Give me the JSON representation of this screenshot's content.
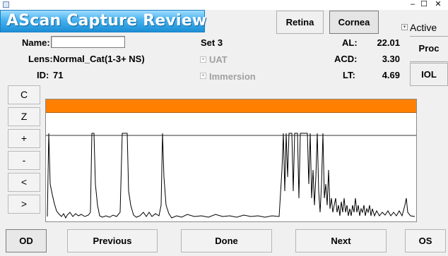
{
  "window": {
    "minimize_glyph": "–",
    "maximize_glyph": "☐",
    "close_glyph": "✕"
  },
  "banner": {
    "title": "AScan Capture Review"
  },
  "tabs": {
    "retina": "Retina",
    "cornea": "Cornea"
  },
  "active": {
    "label": "Active",
    "checked": true
  },
  "patient": {
    "name_label": "Name:",
    "name_value": "",
    "lens_label": "Lens:",
    "lens_value": "Normal_Cat(1-3+ NS)",
    "id_label": "ID:",
    "id_value": "71"
  },
  "set": {
    "label": "Set 3"
  },
  "options": {
    "uat": "UAT",
    "immersion": "Immersion"
  },
  "measurements": {
    "al_label": "AL:",
    "al_value": "22.01",
    "acd_label": "ACD:",
    "acd_value": "3.30",
    "lt_label": "LT:",
    "lt_value": "4.69"
  },
  "right_buttons": {
    "proc": "Proc",
    "iol": "IOL"
  },
  "side_buttons": [
    "C",
    "Z",
    "+",
    "-",
    "<",
    ">"
  ],
  "bottom": {
    "od": "OD",
    "previous": "Previous",
    "done": "Done",
    "next": "Next",
    "os": "OS"
  },
  "colors": {
    "accent_bar": "#ff8000",
    "banner": "#2a9ae0",
    "trace": "#000000"
  }
}
